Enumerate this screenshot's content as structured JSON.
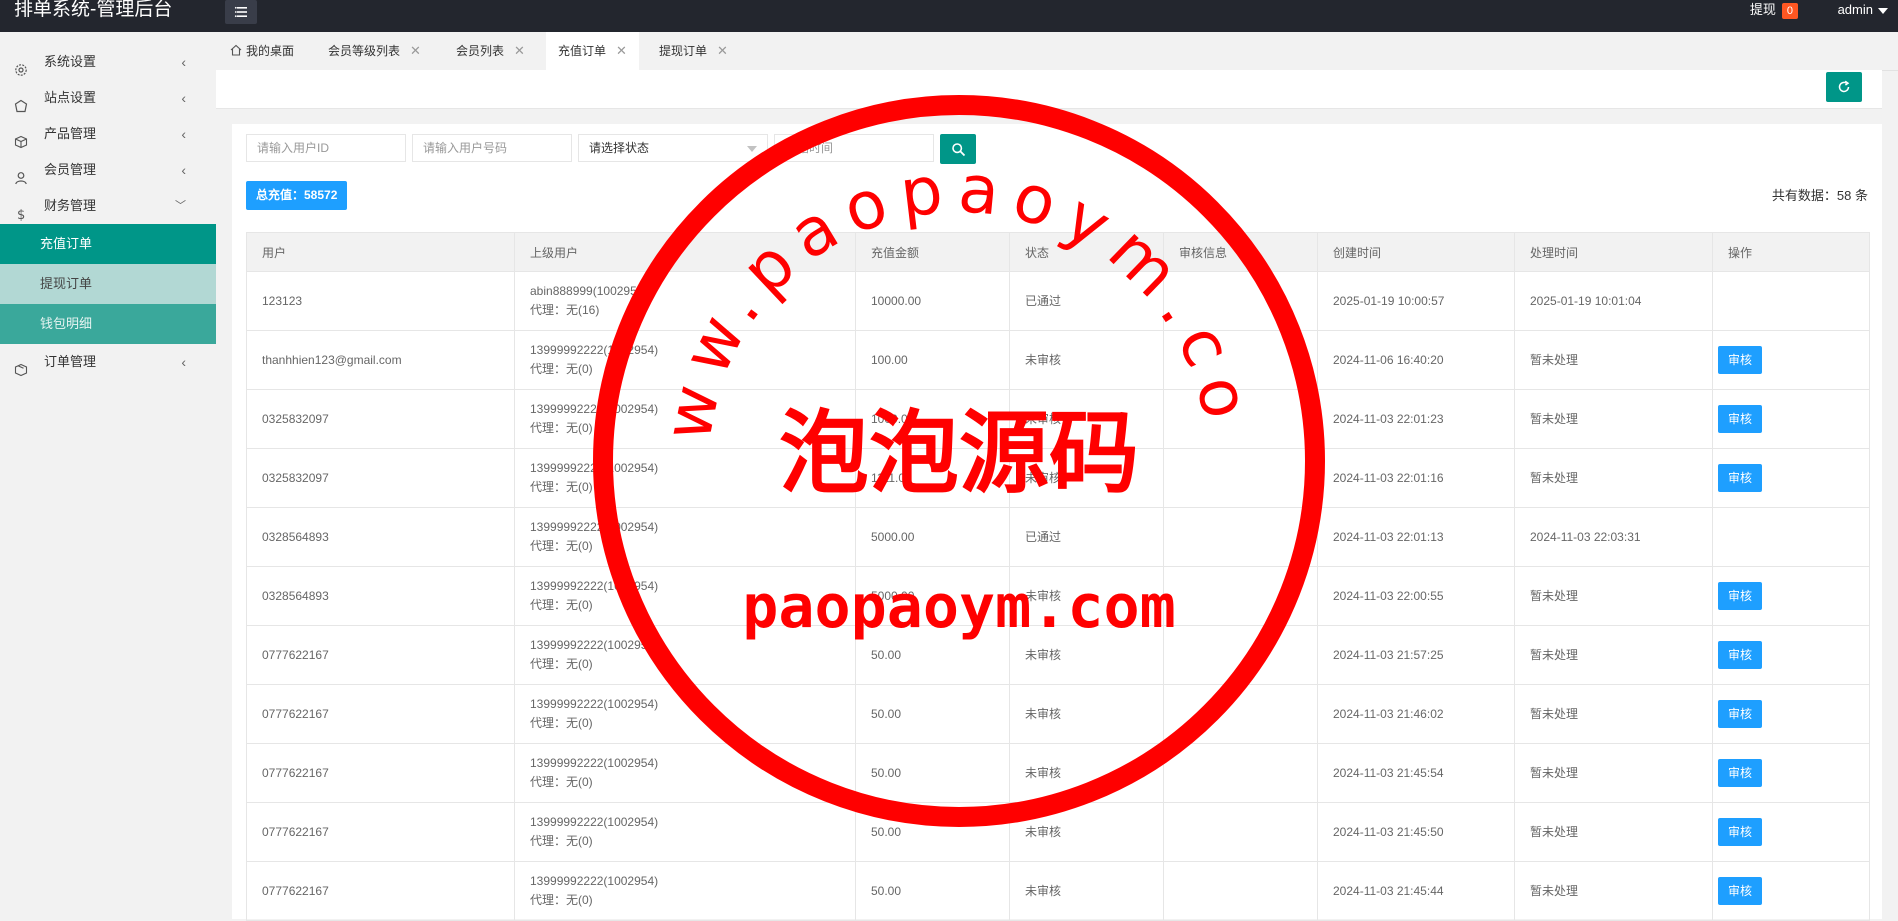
{
  "header": {
    "title": "排单系统-管理后台",
    "withdraw_label": "提现",
    "withdraw_badge": "0",
    "user": "admin"
  },
  "sidebar": {
    "items": [
      {
        "label": "系统设置",
        "icon": "gear-icon"
      },
      {
        "label": "站点设置",
        "icon": "site-icon"
      },
      {
        "label": "产品管理",
        "icon": "cube-icon"
      },
      {
        "label": "会员管理",
        "icon": "user-icon"
      },
      {
        "label": "财务管理",
        "icon": "dollar-icon"
      },
      {
        "label": "订单管理",
        "icon": "box-icon"
      }
    ],
    "finance_sub": [
      "充值订单",
      "提现订单",
      "钱包明细"
    ]
  },
  "tabs": [
    "我的桌面",
    "会员等级列表",
    "会员列表",
    "充值订单",
    "提现订单"
  ],
  "filters": {
    "user_id_placeholder": "请输入用户ID",
    "user_no_placeholder": "请输入用户号码",
    "status_select": "请选择状态",
    "start_time_placeholder": "开始时间"
  },
  "summary": {
    "total_label": "总充值：58572",
    "count_label": "共有数据：58 条"
  },
  "table": {
    "headers": [
      "用户",
      "上级用户",
      "充值金额",
      "状态",
      "审核信息",
      "创建时间",
      "处理时间",
      "操作"
    ],
    "action_label": "审核",
    "rows": [
      {
        "user": "123123",
        "parent": "abin888999(1002954)",
        "agent": "代理：无(16)",
        "amount": "10000.00",
        "status": "已通过",
        "audit": "",
        "created": "2025-01-19 10:00:57",
        "handled": "2025-01-19 10:01:04",
        "action": false
      },
      {
        "user": "thanhhien123@gmail.com",
        "parent": "13999992222(1002954)",
        "agent": "代理：无(0)",
        "amount": "100.00",
        "status": "未审核",
        "audit": "",
        "created": "2024-11-06 16:40:20",
        "handled": "暂未处理",
        "action": true
      },
      {
        "user": "0325832097",
        "parent": "13999992222(1002954)",
        "agent": "代理：无(0)",
        "amount": "1000.00",
        "status": "未审核",
        "audit": "",
        "created": "2024-11-03 22:01:23",
        "handled": "暂未处理",
        "action": true
      },
      {
        "user": "0325832097",
        "parent": "13999992222(1002954)",
        "agent": "代理：无(0)",
        "amount": "1111.00",
        "status": "未审核",
        "audit": "",
        "created": "2024-11-03 22:01:16",
        "handled": "暂未处理",
        "action": true
      },
      {
        "user": "0328564893",
        "parent": "13999992222(1002954)",
        "agent": "代理：无(0)",
        "amount": "5000.00",
        "status": "已通过",
        "audit": "",
        "created": "2024-11-03 22:01:13",
        "handled": "2024-11-03 22:03:31",
        "action": false
      },
      {
        "user": "0328564893",
        "parent": "13999992222(1002954)",
        "agent": "代理：无(0)",
        "amount": "5000.00",
        "status": "未审核",
        "audit": "",
        "created": "2024-11-03 22:00:55",
        "handled": "暂未处理",
        "action": true
      },
      {
        "user": "0777622167",
        "parent": "13999992222(1002954)",
        "agent": "代理：无(0)",
        "amount": "50.00",
        "status": "未审核",
        "audit": "",
        "created": "2024-11-03 21:57:25",
        "handled": "暂未处理",
        "action": true
      },
      {
        "user": "0777622167",
        "parent": "13999992222(1002954)",
        "agent": "代理：无(0)",
        "amount": "50.00",
        "status": "未审核",
        "audit": "",
        "created": "2024-11-03 21:46:02",
        "handled": "暂未处理",
        "action": true
      },
      {
        "user": "0777622167",
        "parent": "13999992222(1002954)",
        "agent": "代理：无(0)",
        "amount": "50.00",
        "status": "未审核",
        "audit": "",
        "created": "2024-11-03 21:45:54",
        "handled": "暂未处理",
        "action": true
      },
      {
        "user": "0777622167",
        "parent": "13999992222(1002954)",
        "agent": "代理：无(0)",
        "amount": "50.00",
        "status": "未审核",
        "audit": "",
        "created": "2024-11-03 21:45:50",
        "handled": "暂未处理",
        "action": true
      },
      {
        "user": "0777622167",
        "parent": "13999992222(1002954)",
        "agent": "代理：无(0)",
        "amount": "50.00",
        "status": "未审核",
        "audit": "",
        "created": "2024-11-03 21:45:44",
        "handled": "暂未处理",
        "action": true
      }
    ]
  },
  "watermark": {
    "top_arc": "www.paopaoym.com",
    "center": "泡泡源码",
    "bottom": "paopaoym.com",
    "color": "#ff0000"
  },
  "colors": {
    "accent": "#009688",
    "primary": "#1e9fff",
    "topbar": "#23262e",
    "badge": "#ff5722"
  }
}
